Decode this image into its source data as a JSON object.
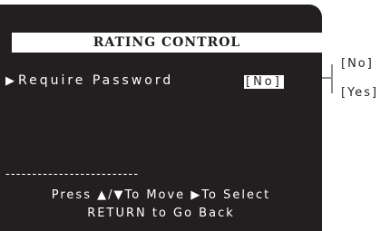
{
  "menu": {
    "title": "RATING CONTROL",
    "item": {
      "arrow": "▶",
      "label": "Require Password",
      "value": "[No]"
    }
  },
  "divider": "-------------------------",
  "hints": {
    "line1": {
      "press": "Press ",
      "up": "▲",
      "slash": "/",
      "down": "▼",
      "move": "To Move ",
      "arrow": "▶",
      "select": "To Select"
    },
    "line2": "RETURN to Go Back"
  },
  "options": [
    "[No]",
    "[Yes]"
  ],
  "colors": {
    "screen": "#231f20",
    "text": "#ffffff",
    "highlight": "#ffffff"
  }
}
